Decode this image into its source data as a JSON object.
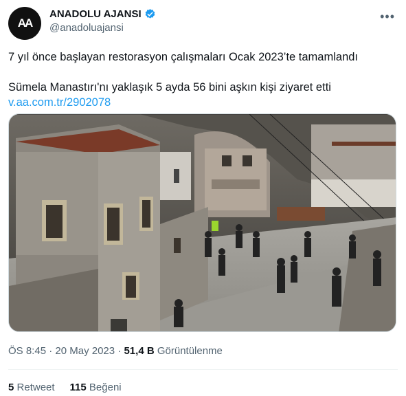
{
  "author": {
    "display_name": "ANADOLU AJANSI",
    "handle": "@anadoluajansi",
    "avatar_text": "AA",
    "verified_icon": "verified-badge-icon"
  },
  "more_icon": "more-icon",
  "tweet": {
    "line1": "7 yıl önce başlayan restorasyon çalışmaları Ocak 2023’te tamamlandı",
    "line2": "Sümela Manastırı'nı yaklaşık 5 ayda 56 bini aşkın kişi ziyaret etti",
    "link": "v.aa.com.tr/2902078"
  },
  "meta": {
    "time": "ÖS 8:45",
    "date": "20 May 2023",
    "views_count": "51,4 B",
    "views_label": "Görüntülenme"
  },
  "stats": {
    "retweets_count": "5",
    "retweets_label": "Retweet",
    "likes_count": "115",
    "likes_label": "Beğeni"
  },
  "colors": {
    "link": "#1d9bf0",
    "muted": "#536471",
    "text": "#0f1419"
  }
}
